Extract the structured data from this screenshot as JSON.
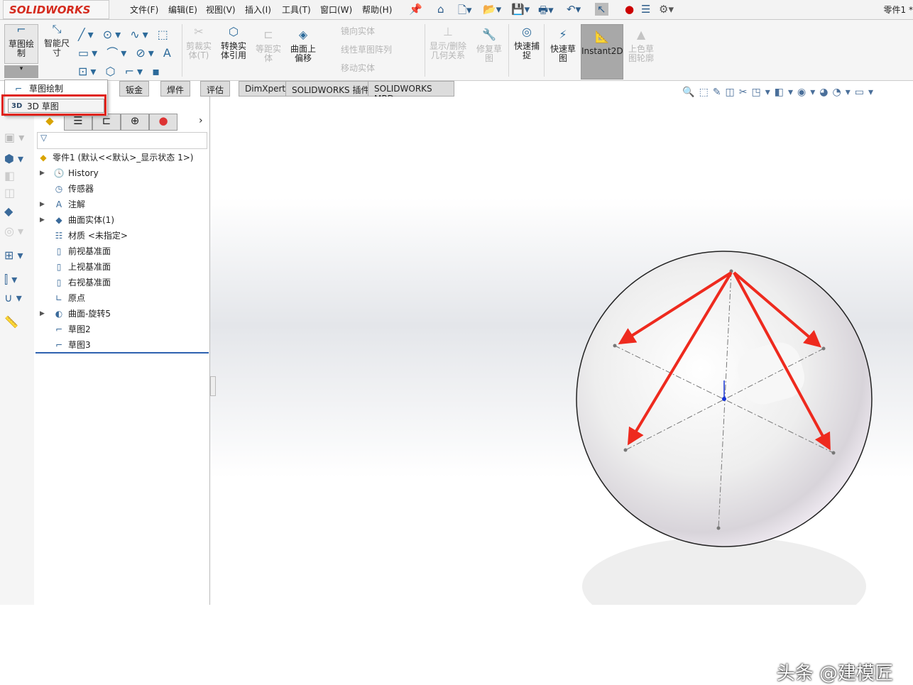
{
  "app": {
    "logo": "SOLIDWORKS",
    "doc_title": "零件1 *"
  },
  "menu": [
    "文件(F)",
    "编辑(E)",
    "视图(V)",
    "插入(I)",
    "工具(T)",
    "窗口(W)",
    "帮助(H)"
  ],
  "ribbon": {
    "sketch": "草图绘制",
    "smart_dim": "智能尺寸",
    "trim": "剪裁实体(T)",
    "convert": "转换实体引用",
    "offset": "等距实体",
    "surface_offset": "曲面上偏移",
    "mirror": "镜向实体",
    "linear_pattern": "线性草图阵列",
    "move": "移动实体",
    "relations": "显示/删除几何关系",
    "repair": "修复草图",
    "quick_snap": "快速捕捉",
    "rapid_sketch": "快速草图",
    "instant2d": "Instant2D",
    "shaded": "上色草图轮廓"
  },
  "tabs": [
    "钣金",
    "焊件",
    "评估",
    "DimXpert",
    "SOLIDWORKS 插件",
    "SOLIDWORKS MBD"
  ],
  "dropdown": {
    "items": [
      "草图绘制",
      "3D 草图"
    ],
    "highlighted": "3D 草图"
  },
  "tree": {
    "root": "零件1  (默认<<默认>_显示状态 1>)",
    "items": [
      {
        "label": "History",
        "expand": true
      },
      {
        "label": "传感器",
        "expand": false
      },
      {
        "label": "注解",
        "expand": true
      },
      {
        "label": "曲面实体(1)",
        "expand": true
      },
      {
        "label": "材质 <未指定>",
        "expand": false
      },
      {
        "label": "前视基准面",
        "expand": false
      },
      {
        "label": "上视基准面",
        "expand": false
      },
      {
        "label": "右视基准面",
        "expand": false
      },
      {
        "label": "原点",
        "expand": false
      },
      {
        "label": "曲面-旋转5",
        "expand": true
      },
      {
        "label": "草图2",
        "expand": false
      },
      {
        "label": "草图3",
        "expand": false
      }
    ]
  },
  "watermark": "头条 @建模匠",
  "colors": {
    "highlight": "#e0241c",
    "arrow": "#ee2a1e",
    "brand": "#d52b1e"
  }
}
